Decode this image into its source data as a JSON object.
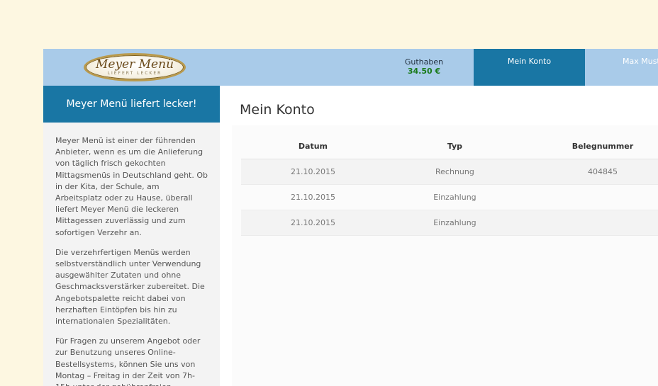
{
  "header": {
    "logo_title": "Meyer Menü",
    "logo_tagline": "LIEFERT LECKER",
    "balance_label": "Guthaben",
    "balance_value": "34.50 €",
    "nav_account": "Mein Konto",
    "nav_user": "Max Must"
  },
  "sidebar": {
    "heading": "Meyer Menü liefert lecker!",
    "paragraphs": [
      "Meyer Menü ist einer der führenden Anbieter, wenn es um die Anlieferung von täglich frisch gekochten Mittagsmenüs in Deutschland geht. Ob in der Kita, der Schule, am Arbeitsplatz oder zu Hause, überall liefert Meyer Menü die leckeren Mittagessen zuverlässig und zum sofortigen Verzehr an.",
      "Die verzehrfertigen Menüs werden selbstverständlich unter Verwendung ausgewählter Zutaten und ohne Geschmacksverstärker zubereitet. Die Angebotspalette reicht dabei von herzhaften Eintöpfen bis hin zu internationalen Spezialitäten.",
      "Für Fragen zu unserem Angebot oder zur Benutzung unseres Online-Bestellsystems, können Sie uns von Montag – Freitag in der Zeit von 7h-15h unter der gebührenfreien Rufnummer"
    ]
  },
  "main": {
    "title": "Mein Konto",
    "columns": [
      "Datum",
      "Typ",
      "Belegnummer"
    ],
    "rows": [
      {
        "date": "21.10.2015",
        "type": "Rechnung",
        "number": "404845"
      },
      {
        "date": "21.10.2015",
        "type": "Einzahlung",
        "number": ""
      },
      {
        "date": "21.10.2015",
        "type": "Einzahlung",
        "number": ""
      }
    ]
  },
  "colors": {
    "page_background": "#fdf7e1",
    "topbar": "#a9cbe9",
    "accent": "#1976a4",
    "balance": "#1a7a1a"
  }
}
